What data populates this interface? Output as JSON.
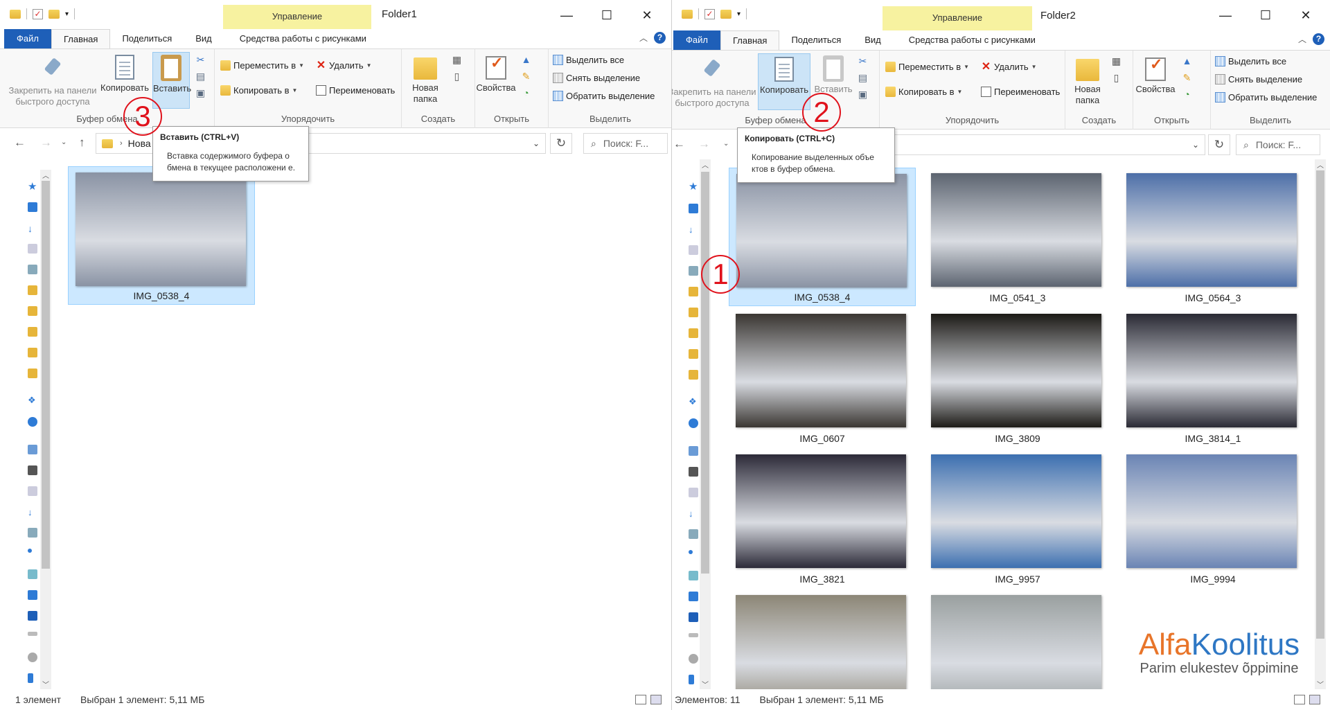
{
  "left_window": {
    "title": "Folder1",
    "context_tab": "Управление",
    "tabs": [
      "Файл",
      "Главная",
      "Поделиться",
      "Вид",
      "Средства работы с рисунками"
    ],
    "ribbon": {
      "pin": "Закрепить на панели быстрого доступа",
      "copy": "Копировать",
      "paste": "Вставить",
      "group_clipboard": "Буфер обмена",
      "move": "Переместить в",
      "copy_to": "Копировать в",
      "delete": "Удалить",
      "rename": "Переименовать",
      "group_organize": "Упорядочить",
      "new_folder": "Новая папка",
      "group_create": "Создать",
      "properties": "Свойства",
      "group_open": "Открыть",
      "select_all": "Выделить все",
      "select_none": "Снять выделение",
      "invert": "Обратить выделение",
      "group_select": "Выделить"
    },
    "address_crumb": "Нова",
    "search_placeholder": "Поиск: F...",
    "files": [
      {
        "name": "IMG_0538_4",
        "selected": true,
        "tone": "#8a93a4"
      }
    ],
    "status_count": "1 элемент",
    "status_selected": "Выбран 1 элемент: 5,11 МБ",
    "tooltip": {
      "title": "Вставить (CTRL+V)",
      "body": "Вставка содержимого буфера о бмена в текущее расположени е."
    },
    "step": "3"
  },
  "right_window": {
    "title": "Folder2",
    "context_tab": "Управление",
    "tabs": [
      "Файл",
      "Главная",
      "Поделиться",
      "Вид",
      "Средства работы с рисунками"
    ],
    "ribbon": {
      "pin": "Закрепить на панели быстрого доступа",
      "copy": "Копировать",
      "paste": "Вставить",
      "group_clipboard": "Буфер обмена",
      "move": "Переместить в",
      "copy_to": "Копировать в",
      "delete": "Удалить",
      "rename": "Переименовать",
      "group_organize": "Упорядочить",
      "new_folder": "Новая папка",
      "group_create": "Создать",
      "properties": "Свойства",
      "group_open": "Открыть",
      "select_all": "Выделить все",
      "select_none": "Снять выделение",
      "invert": "Обратить выделение",
      "group_select": "Выделить"
    },
    "search_placeholder": "Поиск: F...",
    "files": [
      {
        "name": "IMG_0538_4",
        "selected": true,
        "tone": "#8a93a4"
      },
      {
        "name": "IMG_0541_3",
        "selected": false,
        "tone": "#5c6470"
      },
      {
        "name": "IMG_0564_3",
        "selected": false,
        "tone": "#4d6fa8"
      },
      {
        "name": "IMG_0607",
        "selected": false,
        "tone": "#3a3632"
      },
      {
        "name": "IMG_3809",
        "selected": false,
        "tone": "#1c1a16"
      },
      {
        "name": "IMG_3814_1",
        "selected": false,
        "tone": "#2a2a34"
      },
      {
        "name": "IMG_3821",
        "selected": false,
        "tone": "#2c2a38"
      },
      {
        "name": "IMG_9957",
        "selected": false,
        "tone": "#3c6fb0"
      },
      {
        "name": "IMG_9994",
        "selected": false,
        "tone": "#6a84b4"
      },
      {
        "name": "",
        "selected": false,
        "tone": "#8c8676"
      },
      {
        "name": "",
        "selected": false,
        "tone": "#9aa0a0"
      }
    ],
    "status_count": "Элементов: 11",
    "status_selected": "Выбран 1 элемент: 5,11 МБ",
    "tooltip": {
      "title": "Копировать (CTRL+C)",
      "body": "Копирование выделенных объе ктов в буфер обмена."
    },
    "step_1": "1",
    "step_2": "2"
  },
  "watermark": {
    "brand_a": "Alfa",
    "brand_b": "Koolitus",
    "tagline": "Parim elukestev õppimine"
  },
  "icons": [
    "folder-icon",
    "checkbox-icon",
    "pin-icon",
    "copy-icon",
    "paste-icon",
    "scissors-icon",
    "delete-icon",
    "folder-icon",
    "properties-icon",
    "refresh-icon",
    "search-icon",
    "back-icon",
    "forward-icon",
    "up-icon"
  ],
  "colors": {
    "file_tab": "#1e5fb8",
    "manage_band": "#f7f2a0",
    "selection": "#cce8ff",
    "step_circle": "#e0121c"
  }
}
